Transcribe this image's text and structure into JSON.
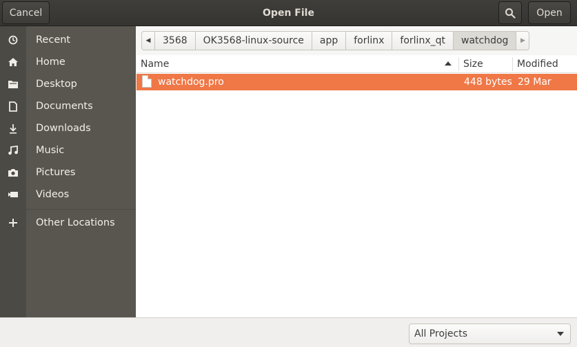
{
  "header": {
    "title": "Open File",
    "cancel_label": "Cancel",
    "open_label": "Open"
  },
  "sidebar": {
    "items": [
      {
        "label": "Recent",
        "icon": "clock-icon"
      },
      {
        "label": "Home",
        "icon": "home-icon"
      },
      {
        "label": "Desktop",
        "icon": "folder-icon"
      },
      {
        "label": "Documents",
        "icon": "document-icon"
      },
      {
        "label": "Downloads",
        "icon": "download-icon"
      },
      {
        "label": "Music",
        "icon": "music-icon"
      },
      {
        "label": "Pictures",
        "icon": "camera-icon"
      },
      {
        "label": "Videos",
        "icon": "video-icon"
      },
      {
        "label": "Other Locations",
        "icon": "plus-icon"
      }
    ]
  },
  "pathbar": {
    "crumbs": [
      "3568",
      "OK3568-linux-source",
      "app",
      "forlinx",
      "forlinx_qt",
      "watchdog"
    ],
    "active_index": 5
  },
  "file_list": {
    "columns": {
      "name": "Name",
      "size": "Size",
      "modified": "Modified"
    },
    "sort": "name-ascending",
    "rows": [
      {
        "name": "watchdog.pro",
        "size": "448 bytes",
        "modified": "29 Mar",
        "selected": true
      }
    ]
  },
  "filter": {
    "selected": "All Projects"
  },
  "colors": {
    "accent": "#f07746",
    "headerbar": "#3b3936",
    "sidebar": "#595650"
  }
}
